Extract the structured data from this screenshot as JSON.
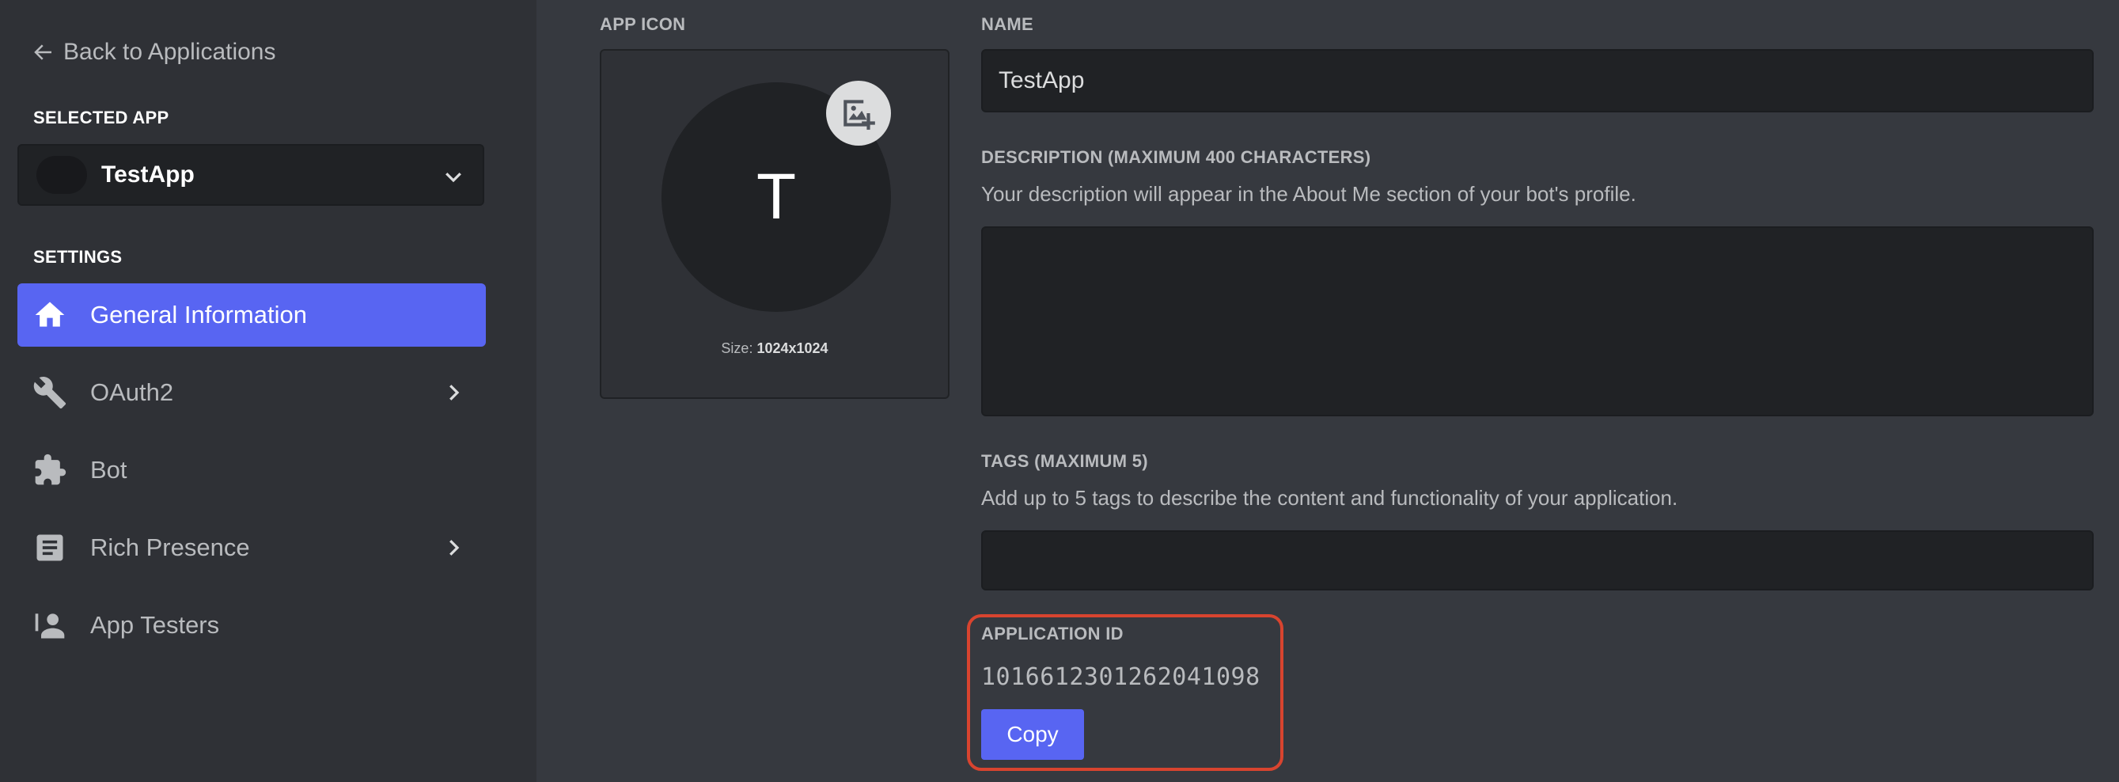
{
  "sidebar": {
    "back_label": "Back to Applications",
    "selected_app_heading": "SELECTED APP",
    "selected_app_name": "TestApp",
    "settings_heading": "SETTINGS",
    "items": [
      {
        "label": "General Information",
        "icon": "home-icon",
        "active": true
      },
      {
        "label": "OAuth2",
        "icon": "wrench-icon",
        "has_chevron": true
      },
      {
        "label": "Bot",
        "icon": "puzzle-icon"
      },
      {
        "label": "Rich Presence",
        "icon": "document-icon",
        "has_chevron": true
      },
      {
        "label": "App Testers",
        "icon": "person-icon"
      }
    ]
  },
  "main": {
    "app_icon_label": "APP ICON",
    "icon_letter": "T",
    "size_prefix": "Size: ",
    "size_value": "1024x1024",
    "name_label": "NAME",
    "name_value": "TestApp",
    "description_label": "DESCRIPTION (MAXIMUM 400 CHARACTERS)",
    "description_help": "Your description will appear in the About Me section of your bot's profile.",
    "description_value": "",
    "tags_label": "TAGS (MAXIMUM 5)",
    "tags_help": "Add up to 5 tags to describe the content and functionality of your application.",
    "tags_value": "",
    "application_id_label": "APPLICATION ID",
    "application_id": "1016612301262041098",
    "copy_label": "Copy"
  },
  "colors": {
    "accent": "#5865f2",
    "background": "#36393f",
    "sidebar": "#2f3136",
    "input": "#202225",
    "highlight": "#d8442f"
  }
}
